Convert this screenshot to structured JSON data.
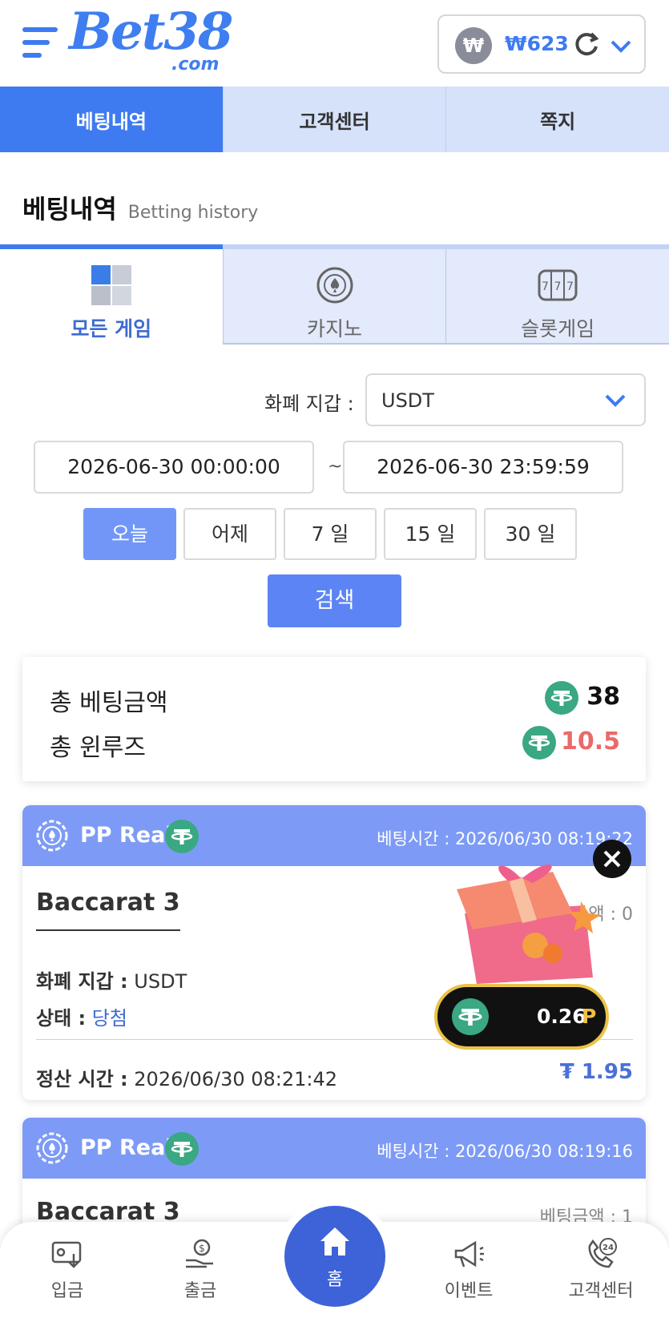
{
  "header": {
    "logo_text": "Bet38",
    "logo_sub": ".com",
    "currency_symbol": "₩",
    "balance": "₩623"
  },
  "top_tabs": [
    "베팅내역",
    "고객센터",
    "쪽지"
  ],
  "page_title": "베팅내역",
  "page_subtitle": "Betting history",
  "game_tabs": [
    "모든 게임",
    "카지노",
    "슬롯게임"
  ],
  "filter": {
    "currency_label": "화폐 지갑 :",
    "currency_value": "USDT",
    "date_from": "2026-06-30 00:00:00",
    "date_sep": "~",
    "date_to": "2026-06-30 23:59:59",
    "quick": [
      "오늘",
      "어제",
      "7 일",
      "15 일",
      "30 일"
    ],
    "search": "검색"
  },
  "summary": {
    "total_bet_label": "총 베팅금액",
    "total_bet_value": "38",
    "total_winloss_label": "총 윈루즈",
    "total_winloss_value": "10.5"
  },
  "bets": [
    {
      "provider": "PP Real",
      "time_label": "베팅시간 : 2026/06/30 08:19:22",
      "game": "Baccarat 3",
      "bet_amount": "액 : 0",
      "currency_label": "화폐 지갑 :",
      "currency": "USDT",
      "status_label": "상태 :",
      "status": "당첨",
      "settle_label": "정산 시간 :",
      "settle_time": "2026/06/30 08:21:42",
      "payout": "₮ 1.95"
    },
    {
      "provider": "PP Real",
      "time_label": "베팅시간 : 2026/06/30 08:19:16",
      "game": "Baccarat 3",
      "bet_amount": "베팅금액 : 1"
    }
  ],
  "promo": {
    "amount": "0.26",
    "unit": "P"
  },
  "bottom_nav": [
    "입금",
    "출금",
    "홈",
    "이벤트",
    "고객센터"
  ],
  "colors": {
    "primary": "#3e7bf0",
    "card_header": "#7d9bf6",
    "tether": "#3aa882",
    "loss": "#e96a6a"
  }
}
